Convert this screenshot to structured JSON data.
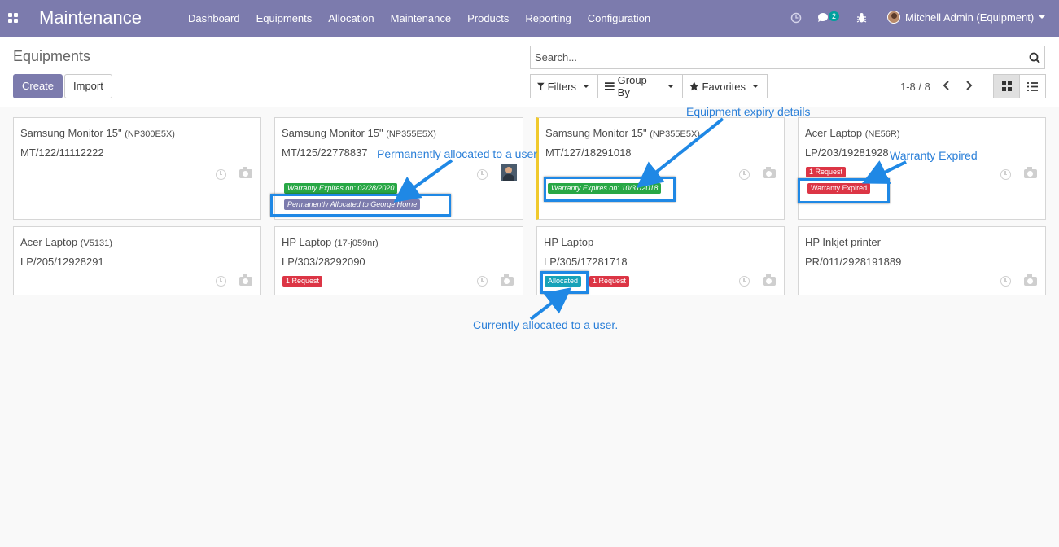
{
  "navbar": {
    "brand": "Maintenance",
    "menu": [
      "Dashboard",
      "Equipments",
      "Allocation",
      "Maintenance",
      "Products",
      "Reporting",
      "Configuration"
    ],
    "message_count": "2",
    "user": "Mitchell Admin (Equipment)",
    "icons": [
      "apps-icon",
      "clock-icon",
      "chat-icon",
      "bug-icon"
    ]
  },
  "control": {
    "breadcrumb": "Equipments",
    "create_label": "Create",
    "import_label": "Import",
    "search_placeholder": "Search...",
    "filters_label": "Filters",
    "groupby_label": "Group By",
    "favorites_label": "Favorites",
    "pager": "1-8 / 8"
  },
  "cards": [
    {
      "name": "Samsung Monitor 15\"",
      "model": "(NP300E5X)",
      "serial": "MT/122/11112222"
    },
    {
      "name": "Samsung Monitor 15\"",
      "model": "(NP355E5X)",
      "serial": "MT/125/22778837",
      "tag1": "Warranty Expires on: 02/28/2020",
      "tag2": "Permanently Allocated to George Horne"
    },
    {
      "name": "Samsung Monitor 15\"",
      "model": "(NP355E5X)",
      "serial": "MT/127/18291018",
      "tag1": "Warranty Expires on: 10/31/2018"
    },
    {
      "name": "Acer Laptop",
      "model": "(NE56R)",
      "serial": "LP/203/19281928",
      "tag1": "1 Request",
      "tag2": "Warranty Expired"
    },
    {
      "name": "Acer Laptop",
      "model": "(V5131)",
      "serial": "LP/205/12928291"
    },
    {
      "name": "HP Laptop",
      "model": "(17-j059nr)",
      "serial": "LP/303/28292090",
      "tag1": "1 Request"
    },
    {
      "name": "HP Laptop",
      "model": "",
      "serial": "LP/305/17281718",
      "tag1": "Allocated",
      "tag2": "1 Request"
    },
    {
      "name": "HP Inkjet printer",
      "model": "",
      "serial": "PR/011/2928191889"
    }
  ],
  "annotations": {
    "permanent": "Permanently allocated to a user",
    "expiry": "Equipment expiry details",
    "expired": "Warranty Expired",
    "current": "Currently allocated to a user."
  },
  "colors": {
    "navbar": "#7c7bad",
    "annotation": "#1f88e5",
    "tag_green": "#28a745",
    "tag_red": "#dc3545",
    "tag_teal": "#17a2b8"
  }
}
